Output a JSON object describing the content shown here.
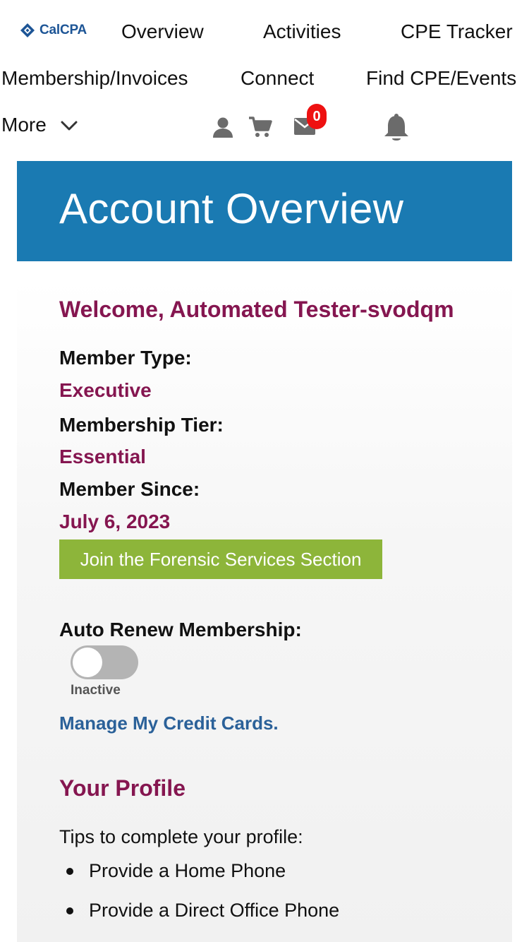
{
  "brand": {
    "logo_text": "CalCPA"
  },
  "nav": {
    "overview": "Overview",
    "activities": "Activities",
    "cpe_tracker": "CPE Tracker",
    "membership_invoices": "Membership/Invoices",
    "connect": "Connect",
    "find_cpe_events": "Find CPE/Events",
    "more": "More"
  },
  "icons": {
    "profile": "user-icon",
    "cart": "cart-icon",
    "messages": "mail-icon",
    "notifications": "bell-icon",
    "messages_badge": "0"
  },
  "header": {
    "title": "Account Overview"
  },
  "account": {
    "welcome": "Welcome, Automated Tester-svodqm",
    "member_type_label": "Member Type:",
    "member_type_value": "Executive",
    "membership_tier_label": "Membership Tier:",
    "membership_tier_value": "Essential",
    "member_since_label": "Member Since:",
    "member_since_value": "July 6, 2023",
    "join_button": "Join the Forensic Services Section",
    "auto_renew_label": "Auto Renew Membership:",
    "auto_renew_status": "Inactive",
    "manage_cards_link": "Manage My Credit Cards."
  },
  "profile": {
    "title": "Your Profile",
    "tips_intro": "Tips to complete your profile:",
    "tips": [
      "Provide a Home Phone",
      "Provide a Direct Office Phone"
    ]
  },
  "colors": {
    "banner": "#1a7ab2",
    "accent": "#851650",
    "button": "#8db53a",
    "link": "#2b6199",
    "badge": "#ee1111"
  }
}
